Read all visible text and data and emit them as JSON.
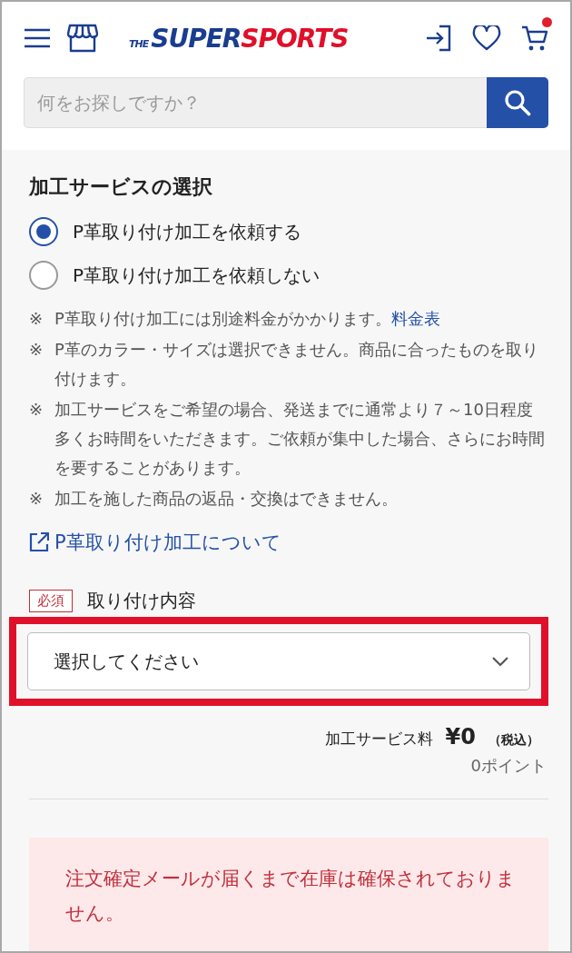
{
  "header": {
    "logo": {
      "prefix": "THE",
      "first": "SUPER",
      "second": "SPORTS"
    },
    "cart_has_items": true
  },
  "search": {
    "placeholder": "何をお探しですか？"
  },
  "service": {
    "title": "加工サービスの選択",
    "options": [
      {
        "label": "P革取り付け加工を依頼する",
        "selected": true
      },
      {
        "label": "P革取り付け加工を依頼しない",
        "selected": false
      }
    ],
    "notes": [
      {
        "mark": "※",
        "text": "P革取り付け加工には別途料金がかかります。",
        "link": "料金表"
      },
      {
        "mark": "※",
        "text": "P革のカラー・サイズは選択できません。商品に合ったものを取り付けます。"
      },
      {
        "mark": "※",
        "text": "加工サービスをご希望の場合、発送までに通常より７～10日程度多くお時間をいただきます。ご依頼が集中した場合、さらにお時間を要することがあります。"
      },
      {
        "mark": "※",
        "text": "加工を施した商品の返品・交換はできません。"
      }
    ],
    "about_link": "P革取り付け加工について",
    "field": {
      "badge": "必須",
      "label": "取り付け内容",
      "placeholder": "選択してください",
      "highlighted": true
    },
    "fee": {
      "label": "加工サービス料",
      "price": "¥0",
      "tax": "（税込）",
      "points": "0ポイント"
    }
  },
  "notice": {
    "text": "注文確定メールが届くまで在庫は確保されておりません。"
  }
}
